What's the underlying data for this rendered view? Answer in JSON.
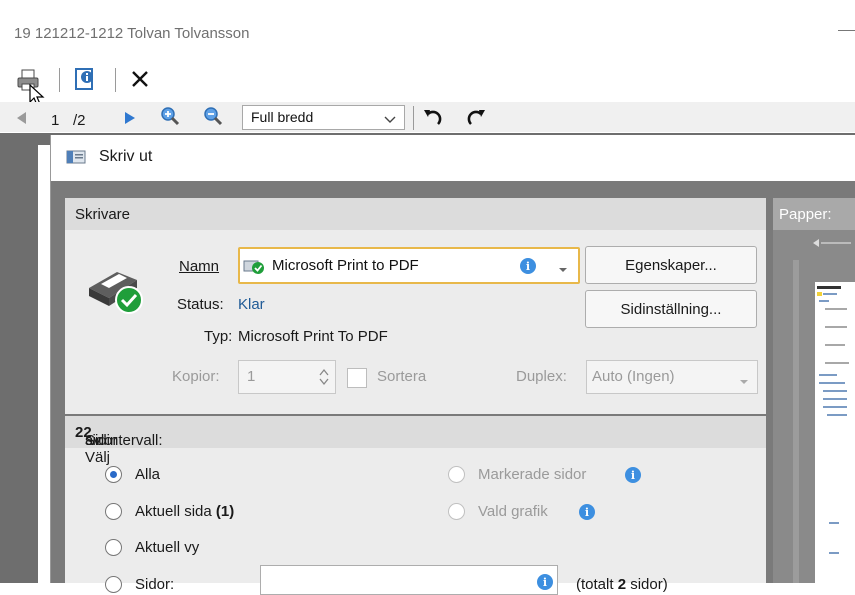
{
  "viewer": {
    "title": "19 121212-1212 Tolvan Tolvansson",
    "page_current": "1",
    "page_total": "/2",
    "zoom": "Full bredd"
  },
  "dialog": {
    "title": "Skriv ut",
    "printer_section": {
      "heading": "Skrivare",
      "name_label": "Namn",
      "name_value": "Microsoft Print to PDF",
      "properties_button": "Egenskaper...",
      "page_setup_button": "Sidinställning...",
      "status_label": "Status:",
      "status_value": "Klar",
      "type_label": "Typ:",
      "type_value": "Microsoft Print To PDF",
      "copies_label": "Kopior:",
      "copies_value": "1",
      "collate_label": "Sortera",
      "duplex_label": "Duplex:",
      "duplex_value": "Auto (Ingen)"
    },
    "range_section": {
      "heading_prefix": "Sidintervall: Välj ",
      "selected": "2",
      "heading_mid": " av ",
      "total": "2",
      "heading_suffix": " sidor",
      "options": {
        "all": "Alla",
        "current_page": "Aktuell sida",
        "current_page_num": "(1)",
        "current_view": "Aktuell vy",
        "pages": "Sidor:",
        "marked_pages": "Markerade sidor",
        "selected_graphic": "Vald grafik",
        "pages_total_prefix": "(totalt ",
        "pages_total_num": "2",
        "pages_total_suffix": " sidor)"
      }
    },
    "preview": {
      "heading": "Papper: "
    }
  },
  "colors": {
    "accent": "#2a6ac8",
    "info_icon": "#3d8fe0",
    "status_blue": "#1f5a96",
    "dialog_bg": "#f0f0f0"
  }
}
